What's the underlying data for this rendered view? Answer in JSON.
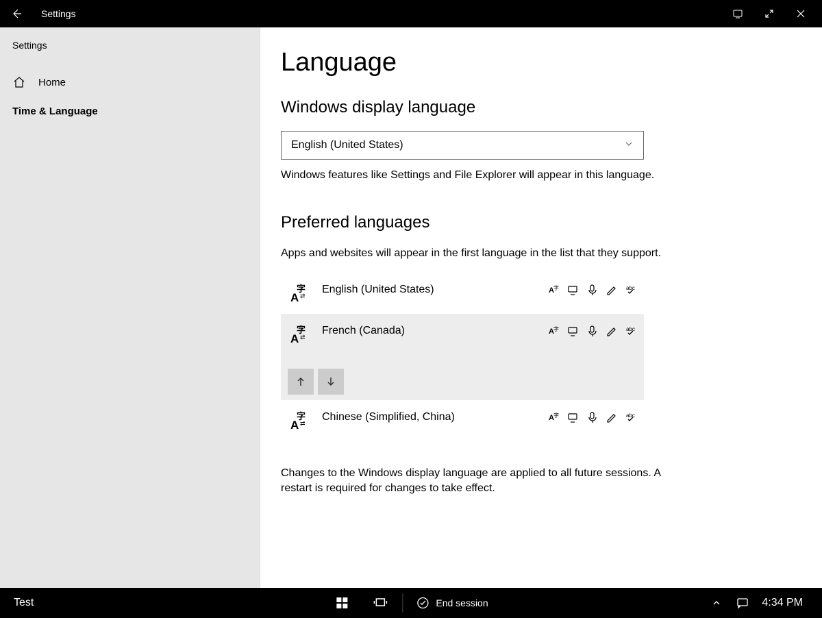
{
  "titlebar": {
    "title": "Settings"
  },
  "sidebar": {
    "header": "Settings",
    "home_label": "Home",
    "category_label": "Time & Language"
  },
  "main": {
    "page_title": "Language",
    "section1_title": "Windows display language",
    "display_language_value": "English (United States)",
    "display_language_help": "Windows features like Settings and File Explorer will appear in this language.",
    "section2_title": "Preferred languages",
    "preferred_help": "Apps and websites will appear in the first language in the list that they support.",
    "languages": [
      {
        "name": "English (United States)",
        "selected": false
      },
      {
        "name": "French (Canada)",
        "selected": true
      },
      {
        "name": "Chinese (Simplified, China)",
        "selected": false
      }
    ],
    "footer_note": "Changes to the Windows display language are applied to all future sessions. A restart is required for changes to take effect."
  },
  "taskbar": {
    "left_label": "Test",
    "end_session_label": "End session",
    "clock": "4:34 PM"
  }
}
